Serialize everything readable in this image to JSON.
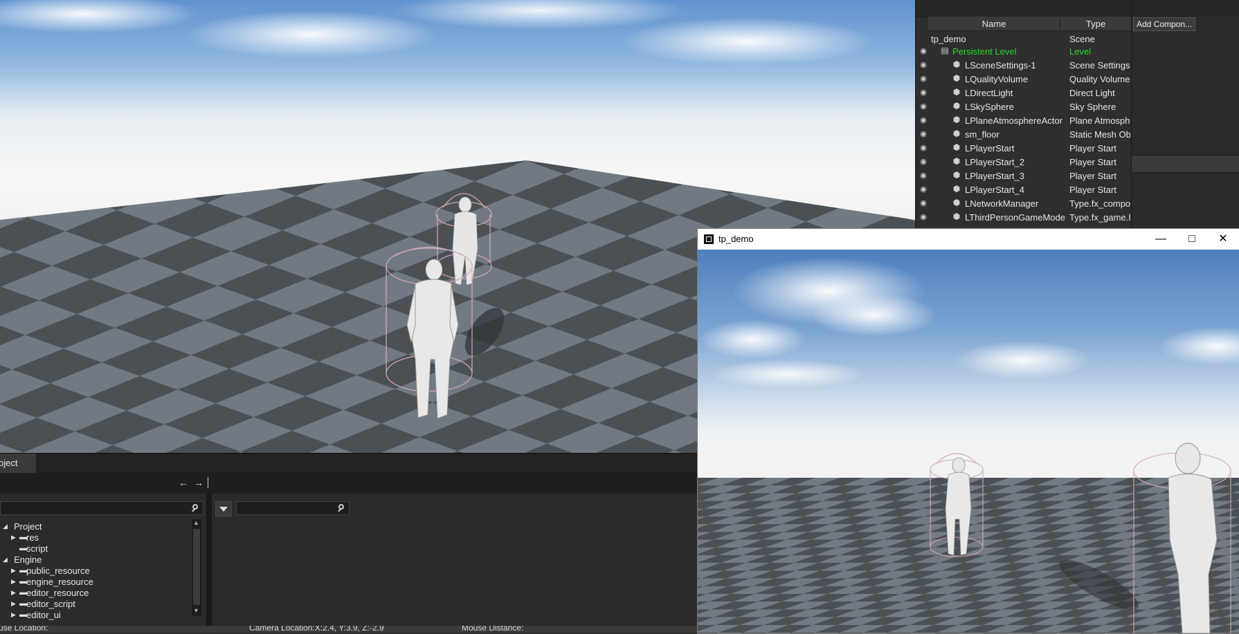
{
  "viewport": {
    "camera_label": "Camera Location:X:2.4, Y:3.9, Z:-2.9"
  },
  "outliner": {
    "columns": {
      "name": "Name",
      "type": "Type"
    },
    "root": {
      "name": "tp_demo",
      "type": "Scene"
    },
    "rows": [
      {
        "name": "Persistent Level",
        "type": "Level",
        "highlight": true
      },
      {
        "name": "LSceneSettings-1",
        "type": "Scene Settings"
      },
      {
        "name": "LQualityVolume",
        "type": "Quality Volume"
      },
      {
        "name": "LDirectLight",
        "type": "Direct Light"
      },
      {
        "name": "LSkySphere",
        "type": "Sky Sphere"
      },
      {
        "name": "LPlaneAtmosphereActor",
        "type": "Plane Atmosph"
      },
      {
        "name": "sm_floor",
        "type": "Static Mesh Ob"
      },
      {
        "name": "LPlayerStart",
        "type": "Player Start"
      },
      {
        "name": "LPlayerStart_2",
        "type": "Player Start"
      },
      {
        "name": "LPlayerStart_3",
        "type": "Player Start"
      },
      {
        "name": "LPlayerStart_4",
        "type": "Player Start"
      },
      {
        "name": "LNetworkManager",
        "type": "Type.fx_compo"
      },
      {
        "name": "LThirdPersonGameMode",
        "type": "Type.fx_game.I"
      }
    ]
  },
  "details": {
    "add_component": "Add Compon..."
  },
  "project": {
    "tab": "oject",
    "tree": [
      {
        "label": "Project",
        "level": 0,
        "expanded": true
      },
      {
        "label": "res",
        "level": 1,
        "expanded": false
      },
      {
        "label": "script",
        "level": 1,
        "leaf": true
      },
      {
        "label": "Engine",
        "level": 0,
        "expanded": true
      },
      {
        "label": "public_resource",
        "level": 1,
        "expanded": false
      },
      {
        "label": "engine_resource",
        "level": 1,
        "expanded": false
      },
      {
        "label": "editor_resource",
        "level": 1,
        "expanded": false
      },
      {
        "label": "editor_script",
        "level": 1,
        "expanded": false
      },
      {
        "label": "editor_ui",
        "level": 1,
        "expanded": false
      }
    ]
  },
  "statusbar": {
    "mouse_location": "use Location:",
    "camera_location": "Camera Location:X:2.4, Y:3.9, Z:-2.9",
    "mouse_distance": "Mouse Distance:"
  },
  "game_window": {
    "title": "tp_demo"
  },
  "colors": {
    "level_green": "#22dd22",
    "panel_bg": "#2b2b2b",
    "floor_dark": "#4a4f54",
    "floor_light": "#6e777f"
  }
}
